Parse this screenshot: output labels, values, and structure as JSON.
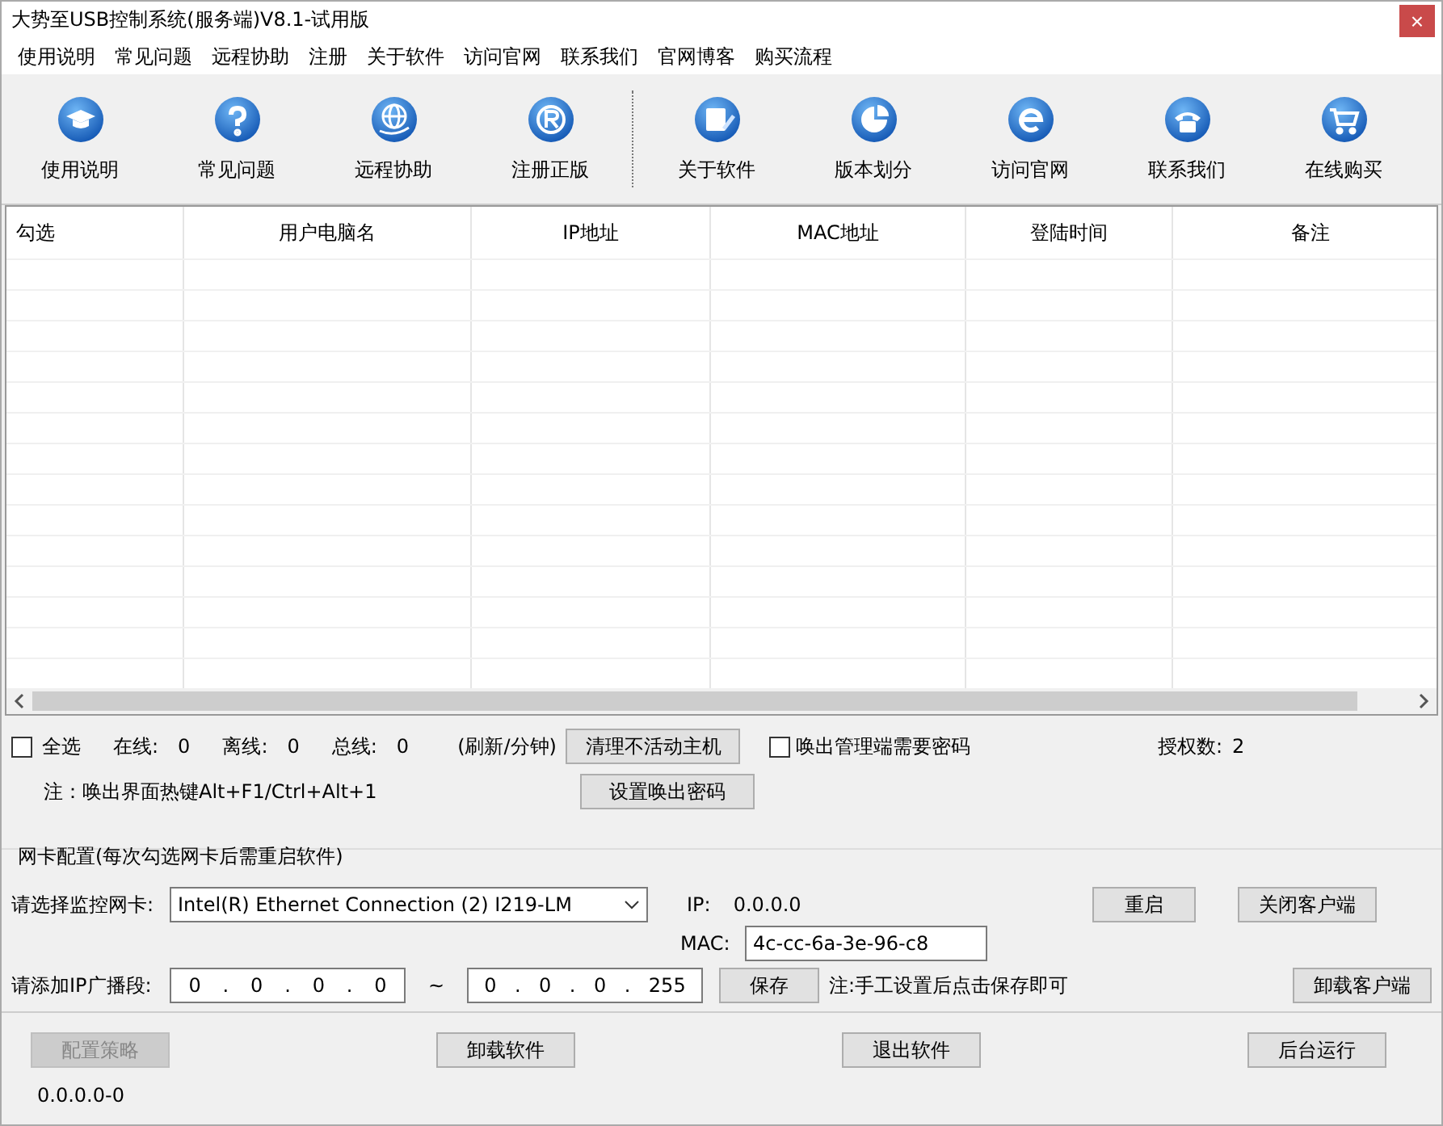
{
  "window": {
    "title": "大势至USB控制系统(服务端)V8.1-试用版",
    "close": "×"
  },
  "menu": [
    "使用说明",
    "常见问题",
    "远程协助",
    "注册",
    "关于软件",
    "访问官网",
    "联系我们",
    "官网博客",
    "购买流程"
  ],
  "toolbar": [
    {
      "label": "使用说明"
    },
    {
      "label": "常见问题"
    },
    {
      "label": "远程协助"
    },
    {
      "label": "注册正版"
    },
    {
      "label": "关于软件"
    },
    {
      "label": "版本划分"
    },
    {
      "label": "访问官网"
    },
    {
      "label": "联系我们"
    },
    {
      "label": "在线购买"
    }
  ],
  "table": {
    "columns": [
      "勾选",
      "用户电脑名",
      "IP地址",
      "MAC地址",
      "登陆时间",
      "备注"
    ]
  },
  "status": {
    "select_all": {
      "label": "全选",
      "checked": false
    },
    "stats": [
      {
        "label": "在线:",
        "value": "0"
      },
      {
        "label": "离线:",
        "value": "0"
      },
      {
        "label": "总线:",
        "value": "0"
      }
    ],
    "refresh": "(刷新/分钟)",
    "clean_button": "清理不活动主机",
    "password_button": "设置唤出密码",
    "password_check": {
      "label": "唤出管理端需要密码",
      "checked": false
    },
    "license_label": "授权数:",
    "license_value": "2",
    "note": "注：唤出界面热键Alt+F1/Ctrl+Alt+1"
  },
  "nic": {
    "title": "网卡配置(每次勾选网卡后需重启软件)",
    "select_label": "请选择监控网卡:",
    "select_value": "Intel(R) Ethernet Connection (2) I219-LM",
    "ip_label": "IP:",
    "ip_value": "0.0.0.0",
    "mac_label": "MAC:",
    "mac_value": "4c-cc-6a-3e-96-c8",
    "range_label": "请添加IP广播段:",
    "ip_from": [
      "0",
      "0",
      "0",
      "0"
    ],
    "tilde": "~",
    "ip_to": [
      "0",
      "0",
      "0",
      "255"
    ],
    "ip_separator": ".",
    "save": "保存",
    "save_note": "注:手工设置后点击保存即可",
    "restart": "重启",
    "close_client": "关闭客户端",
    "uninstall_client": "卸载客户端"
  },
  "bottom": [
    {
      "label": "配置策略",
      "disabled": true
    },
    {
      "label": "卸载软件",
      "disabled": false
    },
    {
      "label": "退出软件",
      "disabled": false
    },
    {
      "label": "后台运行",
      "disabled": false
    }
  ],
  "version": "0.0.0.0-0"
}
